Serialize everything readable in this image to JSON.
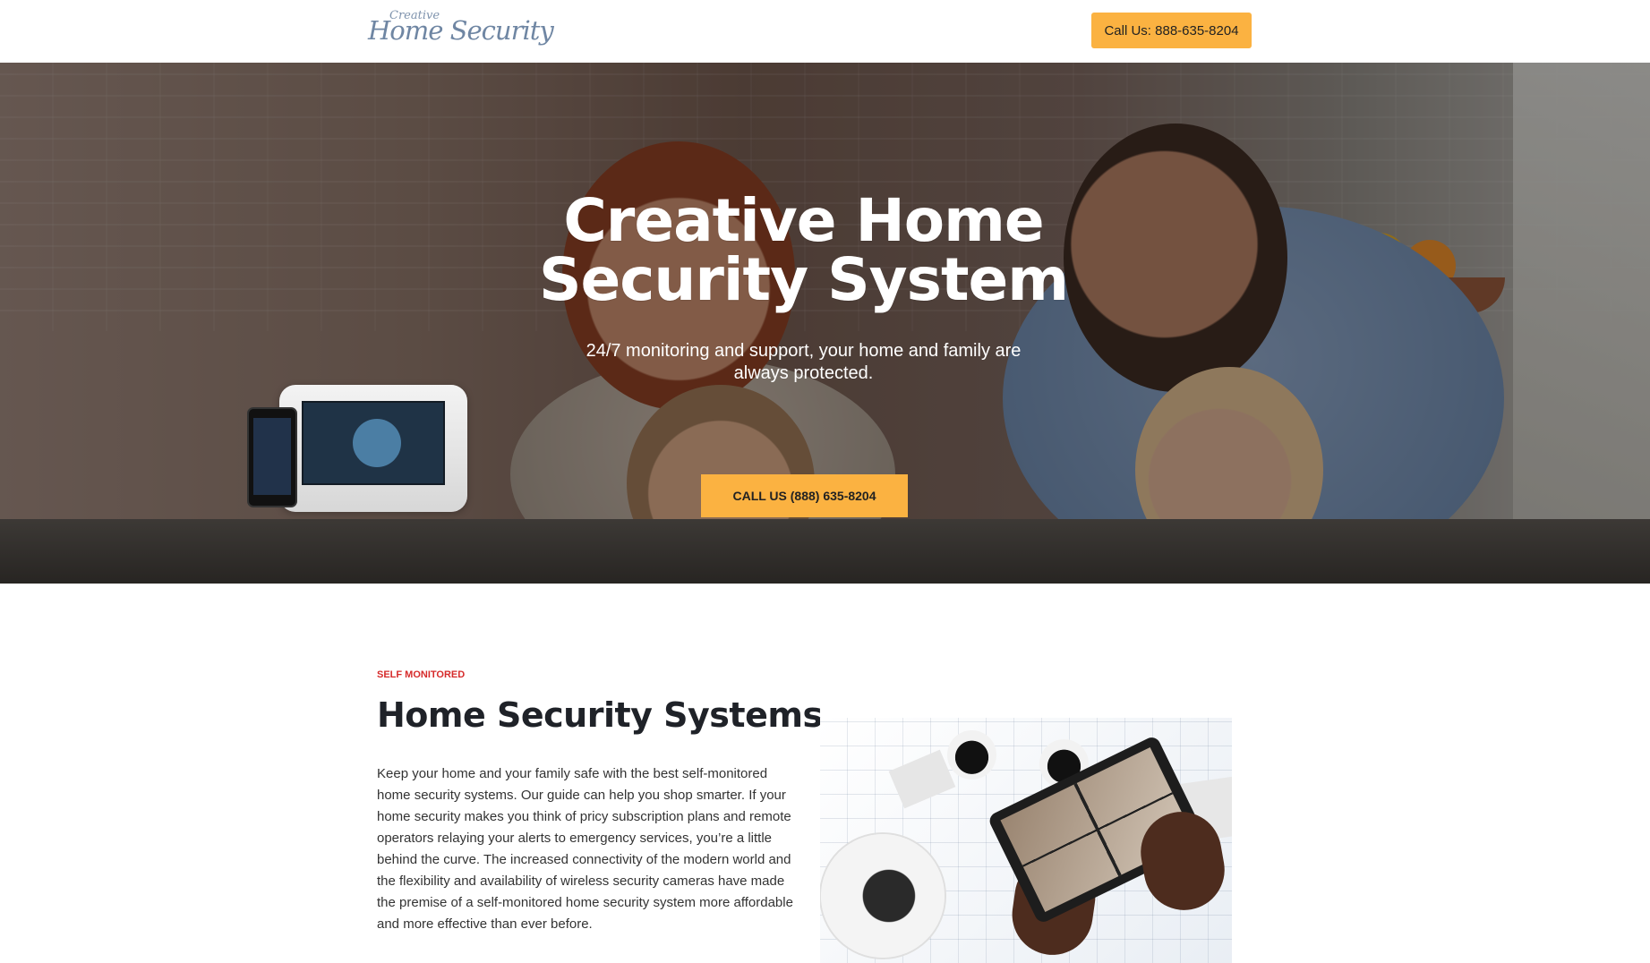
{
  "header": {
    "logo_small": "Creative",
    "logo_main": "Home Security",
    "call_button": "Call Us: 888-635-8204"
  },
  "hero": {
    "title": "Creative Home Security System",
    "subtitle": "24/7 monitoring and support, your home and family are always protected.",
    "cta_label": "CALL US (888) 635-8204"
  },
  "content": {
    "eyebrow": "SELF MONITORED",
    "title": "Home Security Systems",
    "paragraph": "Keep your home and your family safe with the best self-monitored home security systems. Our guide can help you shop smarter. If your home security makes you think of pricy subscription plans and remote operators relaying your alerts to emergency services, you’re a little behind the curve. The increased connectivity of the modern world and the flexibility and availability of wireless security cameras have made the premise of a self-monitored home security system more affordable and more effective than ever before."
  }
}
